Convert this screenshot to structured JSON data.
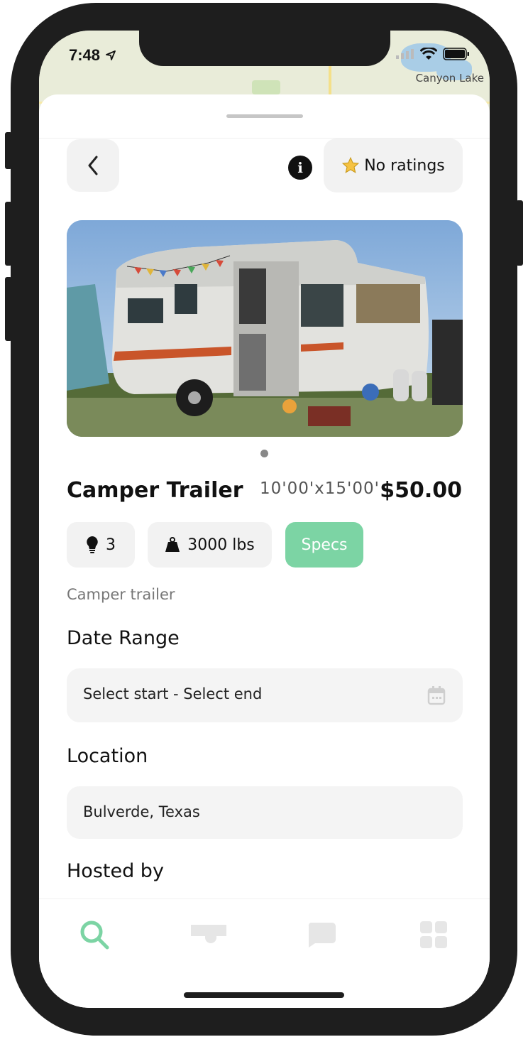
{
  "status_bar": {
    "time": "7:48"
  },
  "map": {
    "label": "Canyon Lake"
  },
  "header": {
    "ratings_label": "No ratings"
  },
  "listing": {
    "title": "Camper Trailer",
    "size": "10'00'x15'00'",
    "price": "$50.00",
    "description": "Camper trailer",
    "photo_count": 1,
    "current_photo": 1
  },
  "chips": {
    "capacity": "3",
    "weight": "3000 lbs",
    "specs_label": "Specs"
  },
  "date_range": {
    "label": "Date Range",
    "value": "Select start - Select end"
  },
  "location": {
    "label": "Location",
    "value": "Bulverde, Texas"
  },
  "host": {
    "label": "Hosted by"
  },
  "tabs": [
    {
      "name": "search",
      "active": true
    },
    {
      "name": "trailers",
      "active": false
    },
    {
      "name": "messages",
      "active": false
    },
    {
      "name": "dashboard",
      "active": false
    }
  ],
  "colors": {
    "accent": "#7cd4a4",
    "star": "#f5c242",
    "inactive_icon": "#e6e6e6"
  }
}
